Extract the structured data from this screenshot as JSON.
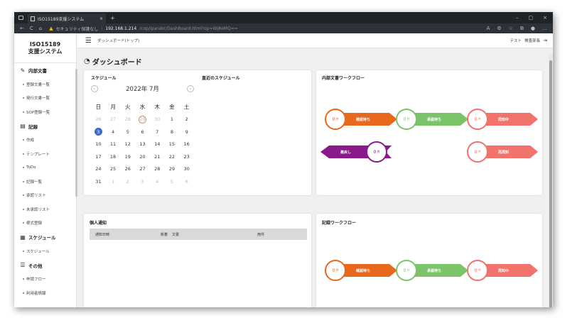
{
  "browser": {
    "tab_title": "ISO15189支援システム",
    "tab_close": "×",
    "new_tab": "+",
    "window_controls": [
      "–",
      "▢",
      "×"
    ],
    "nav_buttons": [
      "←",
      "C",
      "⌂"
    ],
    "security_warning": "セキュリティ保護なし",
    "url_host": "192.168.1.214",
    "url_path": "/cop/iparabc/DashBoard.html?op=Wj8eMQ=="
  },
  "sidebar": {
    "logo_line1": "ISO15189",
    "logo_line2": "支援システム",
    "sections": [
      {
        "label": "内部文書",
        "icon": "edit-icon",
        "items": [
          "登録文書一覧",
          "発行文書一覧",
          "SOP登録一覧"
        ]
      },
      {
        "label": "記録",
        "icon": "document-icon",
        "items": [
          "作成",
          "テンプレート",
          "ToDo",
          "記録一覧",
          "承認リスト",
          "未承認リスト",
          "様式登録"
        ]
      },
      {
        "label": "スケジュール",
        "icon": "calendar-icon",
        "items": [
          "スケジュール"
        ]
      },
      {
        "label": "その他",
        "icon": "database-icon",
        "items": [
          "申請フロー",
          "利用者情報"
        ]
      }
    ]
  },
  "header": {
    "breadcrumb": "ダッシュボード(トップ)",
    "user_name": "テスト",
    "user_role": "検査部長",
    "logout_icon": "logout-icon"
  },
  "page_title": "ダッシュボード",
  "schedule": {
    "title": "スケジュール",
    "upcoming_title": "直近のスケジュール",
    "month_label": "2022年 7月",
    "prev": "‹",
    "next": "›",
    "weekdays": [
      "日",
      "月",
      "火",
      "水",
      "木",
      "金",
      "土"
    ],
    "weeks": [
      [
        "26",
        "27",
        "28",
        "29",
        "30",
        "1",
        "2"
      ],
      [
        "3",
        "4",
        "5",
        "6",
        "7",
        "8",
        "9"
      ],
      [
        "10",
        "11",
        "12",
        "13",
        "14",
        "15",
        "16"
      ],
      [
        "17",
        "18",
        "19",
        "20",
        "21",
        "22",
        "23"
      ],
      [
        "24",
        "25",
        "26",
        "27",
        "28",
        "29",
        "30"
      ],
      [
        "31",
        "1",
        "2",
        "3",
        "4",
        "5",
        "6"
      ]
    ],
    "today": "3"
  },
  "notifications": {
    "title": "個人通知",
    "columns": [
      "通知日時",
      "新着",
      "文書",
      "用件"
    ]
  },
  "internal_workflow": {
    "title": "内部文書ワークフロー",
    "steps": [
      {
        "count": "0",
        "unit": "件",
        "label": "確認待ち",
        "color": "#e8681e"
      },
      {
        "count": "0",
        "unit": "件",
        "label": "承認待ち",
        "color": "#7cc46a"
      },
      {
        "count": "0",
        "unit": "件",
        "label": "周知中",
        "color": "#f2726c"
      },
      {
        "count": "0",
        "unit": "件",
        "label": "差戻し",
        "color": "#8a1a8c"
      },
      {
        "count": "0",
        "unit": "件",
        "label": "再周知",
        "color": "#f2726c"
      }
    ]
  },
  "record_workflow": {
    "title": "記録ワークフロー",
    "steps": [
      {
        "count": "0",
        "unit": "件",
        "label": "確認待ち",
        "color": "#e8681e"
      },
      {
        "count": "0",
        "unit": "件",
        "label": "承認待ち",
        "color": "#7cc46a"
      },
      {
        "count": "0",
        "unit": "件",
        "label": "周知中",
        "color": "#f2726c"
      }
    ]
  }
}
